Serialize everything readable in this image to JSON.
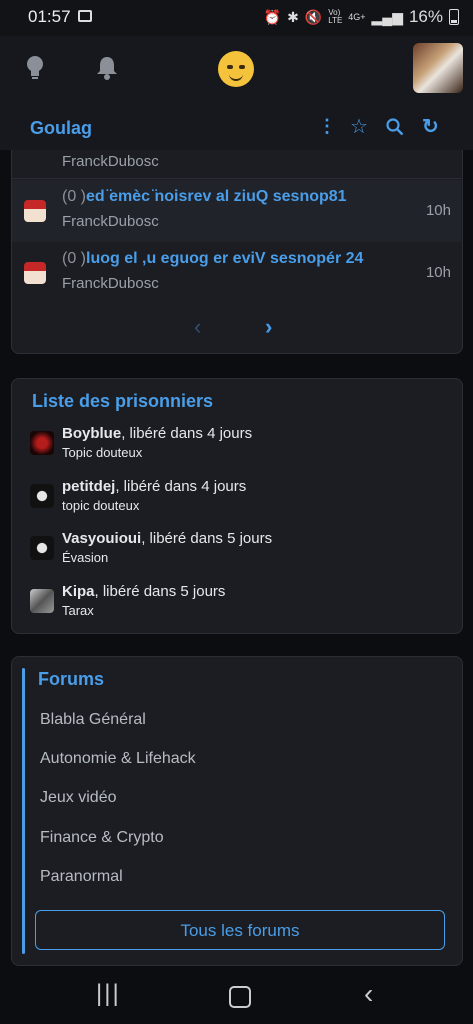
{
  "status_bar": {
    "time": "01:57",
    "icons": [
      "gallery-icon",
      "alarm-icon",
      "bluetooth-icon",
      "mute-icon",
      "volte-icon",
      "4g-icon",
      "signal-icon"
    ],
    "network": "4G+",
    "volte": "Vo) LTE",
    "battery": "16%"
  },
  "app_bar": {
    "icons": [
      "lightbulb-icon",
      "bell-icon",
      "emoji-face-icon",
      "profile-avatar"
    ]
  },
  "section": {
    "title": "Goulag",
    "actions": [
      "more-vert-icon",
      "star-icon",
      "search-icon",
      "refresh-icon"
    ]
  },
  "topics": {
    "partial_author": "FranckDubosc",
    "items": [
      {
        "count": "(0 )",
        "title": "ed ̈emèc ̈noisrev al ziuQ sesnop81",
        "author": "FranckDubosc",
        "time": "10h"
      },
      {
        "count": "(0 )",
        "title": "luog el ,u eguog er eviV sesnopér 24",
        "author": "FranckDubosc",
        "time": "10h"
      }
    ],
    "pager": {
      "prev": "‹",
      "next": "›"
    }
  },
  "prisoners": {
    "title": "Liste des prisonniers",
    "items": [
      {
        "name": "Boyblue",
        "status": ", libéré dans 4 jours",
        "reason": "Topic douteux"
      },
      {
        "name": "petitdej",
        "status": ", libéré dans 4 jours",
        "reason": "topic douteux"
      },
      {
        "name": "Vasyouioui",
        "status": ", libéré dans 5 jours",
        "reason": "Évasion"
      },
      {
        "name": "Kipa",
        "status": ", libéré dans 5 jours",
        "reason": "Tarax"
      }
    ]
  },
  "forums": {
    "title": "Forums",
    "items": [
      "Blabla Général",
      "Autonomie & Lifehack",
      "Jeux vidéo",
      "Finance & Crypto",
      "Paranormal"
    ],
    "all_button": "Tous les forums"
  },
  "colors": {
    "accent": "#4a9de8",
    "background": "#0c0d10",
    "card": "#1b1d22"
  }
}
